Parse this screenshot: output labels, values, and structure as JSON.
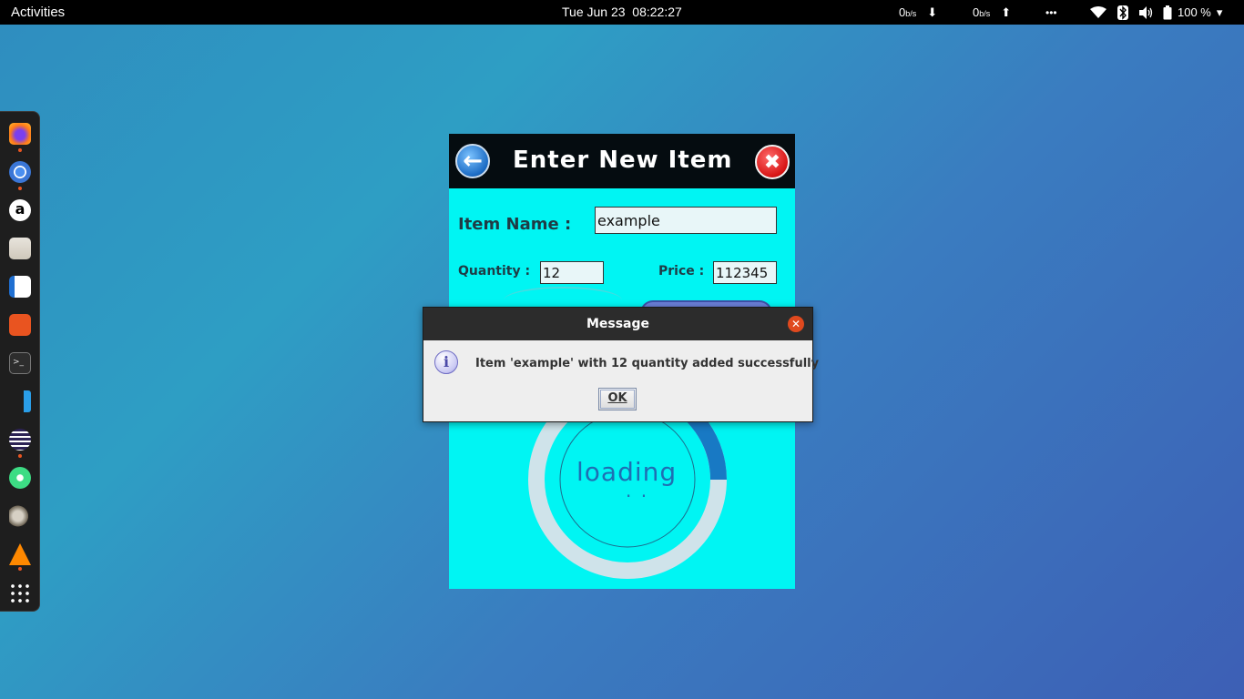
{
  "topbar": {
    "activities": "Activities",
    "clock": "Tue Jun 23  08:22:27",
    "net_down_value": "0",
    "net_down_unit": "b/s",
    "net_up_value": "0",
    "net_up_unit": "b/s",
    "battery": "100 %",
    "down_arrow": "⬇",
    "up_arrow": "⬆",
    "more": "•••",
    "menu_arrow": "▾"
  },
  "dock": {
    "items": [
      "firefox-icon",
      "chromium-icon",
      "amazon-icon",
      "files-icon",
      "writer-icon",
      "software-center-icon",
      "terminal-icon",
      "vscode-icon",
      "eclipse-icon",
      "android-studio-icon",
      "gimp-icon",
      "vlc-icon",
      "app-grid-icon"
    ]
  },
  "app": {
    "title": "Enter New Item",
    "back_symbol": "←",
    "close_symbol": "✖",
    "item_name_label": "Item Name :",
    "item_name_value": "example",
    "quantity_label": "Quantity :",
    "quantity_value": "12",
    "price_label": "Price :",
    "price_value": "112345",
    "loading_text": "loading",
    "loading_dots": ". ."
  },
  "dialog": {
    "title": "Message",
    "message": "Item 'example' with 12 quantity added successfully",
    "ok_label": "OK",
    "info_symbol": "i",
    "close_symbol": "✕"
  },
  "colors": {
    "app_bg": "#00f5f3",
    "header_bg": "#050c10",
    "dialog_title_bg": "#2c2c2c",
    "close_red": "#d71414",
    "accent_orange": "#e95420"
  }
}
